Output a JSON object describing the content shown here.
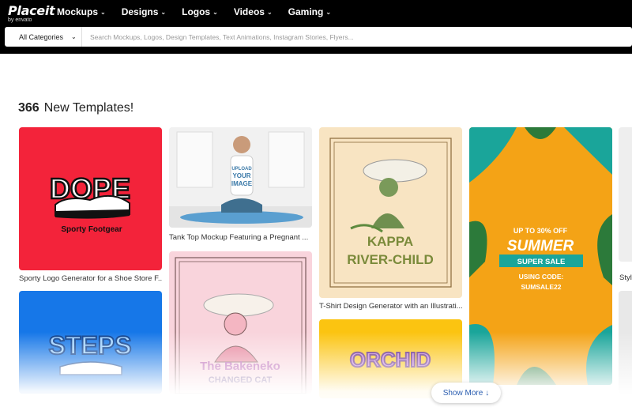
{
  "header": {
    "logo": {
      "brand": "Placeit",
      "by": "by envato"
    },
    "nav": [
      {
        "label": "Mockups"
      },
      {
        "label": "Designs"
      },
      {
        "label": "Logos"
      },
      {
        "label": "Videos"
      },
      {
        "label": "Gaming"
      }
    ],
    "search": {
      "category": "All Categories",
      "placeholder": "Search Mockups, Logos, Design Templates, Text Animations, Instagram Stories, Flyers..."
    }
  },
  "main": {
    "count": "366",
    "heading": "New Templates!",
    "cards": {
      "dope": {
        "caption": "Sporty Logo Generator for a Shoe Store F...",
        "art_title": "DOPE",
        "art_sub": "Sporty Footgear"
      },
      "yoga": {
        "caption": "Tank Top Mockup Featuring a Pregnant ...",
        "art_text": [
          "UPLOAD",
          "YOUR",
          "IMAGE"
        ]
      },
      "kappa": {
        "caption": "T-Shirt Design Generator with an Illustrati...",
        "art_title1": "KAPPA",
        "art_title2": "RIVER-CHILD"
      },
      "summer": {
        "line1": "UP TO 30% OFF",
        "line2": "SUMMER",
        "line3": "SUPER SALE",
        "line4": "USING CODE:",
        "line5": "SUMSALE22"
      },
      "steps": {
        "art_title": "STEPS"
      },
      "bake": {
        "art_title1": "The Bakeneko",
        "art_title2": "CHANGED CAT"
      },
      "orchid": {
        "art_title": "ORCHID"
      },
      "side": {
        "caption": "Styl"
      }
    },
    "show_more": "Show More",
    "show_more_arrow": "↓"
  },
  "colors": {
    "header_bg": "#000000",
    "link": "#2a5db0",
    "dope_bg": "#f3233a",
    "summer_bg": "#f4a316",
    "teal": "#1aa59a"
  }
}
